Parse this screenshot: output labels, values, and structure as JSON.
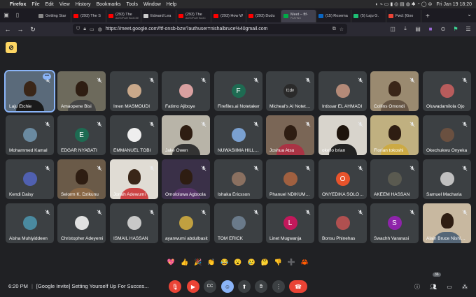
{
  "menubar": {
    "app": "Firefox",
    "items": [
      "File",
      "Edit",
      "View",
      "History",
      "Bookmarks",
      "Tools",
      "Window",
      "Help"
    ],
    "clock": "Fri Jan 19  18:20"
  },
  "tabs": [
    {
      "title": "Getting Star",
      "color": "#888888"
    },
    {
      "title": "(293) The S",
      "color": "#ff0000"
    },
    {
      "title": "(293) The",
      "sub": "AUTOPLAY BLOCKED",
      "color": "#ff0000"
    },
    {
      "title": "Edward Lea",
      "color": "#cccccc"
    },
    {
      "title": "(293) The",
      "sub": "AUTOPLAY BLOC",
      "color": "#ff0000"
    },
    {
      "title": "(293) How W",
      "color": "#ff0000"
    },
    {
      "title": "(293) Dudu",
      "color": "#ff0000"
    },
    {
      "title": "Meet – ftf-",
      "sub": "PLAYING",
      "color": "#00ac47",
      "active": true
    },
    {
      "title": "(15) Rosema",
      "color": "#0a66c2"
    },
    {
      "title": "(5) Laju G.",
      "color": "#1dbf73"
    },
    {
      "title": "Fwd: [Goo",
      "color": "#ea4335"
    }
  ],
  "urlbar": {
    "url": "https://meet.google.com/ftf-onsb-bzw?authuser=nishalbruce%40gmail.com"
  },
  "participants": [
    {
      "name": "Laju Etchie",
      "type": "video",
      "bg": "#5a6a7a",
      "skin": "#3a2618",
      "shirt": "#1a1a1a",
      "selected": true
    },
    {
      "name": "Amaopene Bisi",
      "type": "video",
      "bg": "#6d6a5c",
      "skin": "#2e1d12",
      "shirt": "#444444"
    },
    {
      "name": "Imen MASMOUDI",
      "type": "avatar",
      "color": "#c9a88a"
    },
    {
      "name": "Fatimo Ajiboye",
      "type": "avatar",
      "color": "#d9a0a0"
    },
    {
      "name": "Firefiles.ai Notetaker",
      "type": "letter",
      "letter": "F",
      "color": "#1e6b52"
    },
    {
      "name": "Micheal's AI Notetaker",
      "type": "letter",
      "letter": "tl;dv",
      "color": "#2a2a2a"
    },
    {
      "name": "Intissar EL AHMADI",
      "type": "avatar",
      "color": "#b48a78"
    },
    {
      "name": "Collins Omondi",
      "type": "video",
      "bg": "#9a8a70",
      "skin": "#3a2618",
      "shirt": "#665544"
    },
    {
      "name": "Oluwadamilola Ojo",
      "type": "avatar",
      "color": "#b85c5c"
    },
    {
      "name": "Mohammed Kamal",
      "type": "avatar",
      "color": "#6a8aa0"
    },
    {
      "name": "EDGAR NYABATI",
      "type": "letter",
      "letter": "E",
      "color": "#1e6b52"
    },
    {
      "name": "EMMANUEL TOBI",
      "type": "avatar",
      "color": "#eeeeee"
    },
    {
      "name": "Jake Owen",
      "type": "video",
      "bg": "#b8b4a8",
      "skin": "#2e1d12",
      "shirt": "#333333"
    },
    {
      "name": "NUWASIIMA HILLARY",
      "type": "avatar",
      "color": "#7aa0d0"
    },
    {
      "name": "Joshua Atsu",
      "type": "video",
      "bg": "#7a6656",
      "skin": "#2e1d12",
      "shirt": "#aa3344"
    },
    {
      "name": "okello brian",
      "type": "video",
      "bg": "#d8d4cc",
      "skin": "#1e140c",
      "shirt": "#222222"
    },
    {
      "name": "Florian tokoshi",
      "type": "video",
      "bg": "#c0b080",
      "skin": "#2e1d12",
      "shirt": "#ccaa44"
    },
    {
      "name": "Okechukwu Onyeka",
      "type": "avatar",
      "color": "#6a5040"
    },
    {
      "name": "Kendi Daisy",
      "type": "avatar",
      "color": "#5060b0"
    },
    {
      "name": "Selorm K. Dzikunu",
      "type": "video",
      "bg": "#6a5a48",
      "skin": "#2e1d12",
      "shirt": "#886644"
    },
    {
      "name": "Jonah Adewumi",
      "type": "video",
      "bg": "#e0dcd4",
      "skin": "#3a2618",
      "shirt": "#cc4444"
    },
    {
      "name": "Omololuwa Agboola",
      "type": "video",
      "bg": "#3a3048",
      "skin": "#2e1d12",
      "shirt": "#553366"
    },
    {
      "name": "Ishaka Ericsson",
      "type": "avatar",
      "color": "#8a7060"
    },
    {
      "name": "Phanuel NDIKUMANA",
      "type": "avatar",
      "color": "#a06040"
    },
    {
      "name": "ONYEDIKA SOLOMON",
      "type": "letter",
      "letter": "O",
      "color": "#e8532b"
    },
    {
      "name": "AKEEM HASSAN",
      "type": "avatar",
      "color": "#5a5a50"
    },
    {
      "name": "Samuel Macharia",
      "type": "avatar",
      "color": "#c0c0c0"
    },
    {
      "name": "Aisha Muhiyiddeen",
      "type": "avatar",
      "color": "#4a8aa0"
    },
    {
      "name": "Christopher Adeyemi",
      "type": "avatar",
      "color": "#e0e0e0"
    },
    {
      "name": "ISMAIL HASSAN",
      "type": "avatar",
      "color": "#c8c8c8"
    },
    {
      "name": "ayanwumi abdulbasit",
      "type": "avatar",
      "color": "#c0a040"
    },
    {
      "name": "TOM ERICK",
      "type": "avatar",
      "color": "#6a7a8a"
    },
    {
      "name": "Linet Mugwanja",
      "type": "letter",
      "letter": "L",
      "color": "#c2185b"
    },
    {
      "name": "Bonsu Phinehas",
      "type": "avatar",
      "color": "#b05050"
    },
    {
      "name": "Swachh Varanasi",
      "type": "letter",
      "letter": "S",
      "color": "#8e24aa"
    },
    {
      "name": "Alain Bruce Nishimwe",
      "type": "video",
      "bg": "#c8b8a0",
      "skin": "#2e1d12",
      "shirt": "#556677"
    }
  ],
  "reactions": [
    "💖",
    "👍",
    "🎉",
    "👏",
    "😂",
    "😮",
    "😢",
    "🤔",
    "👎",
    "➕",
    "🦀"
  ],
  "bottombar": {
    "time": "6:20 PM",
    "meeting_title": "[Google Invite] Setting Yourself Up For Succes...",
    "participant_count": "36"
  }
}
